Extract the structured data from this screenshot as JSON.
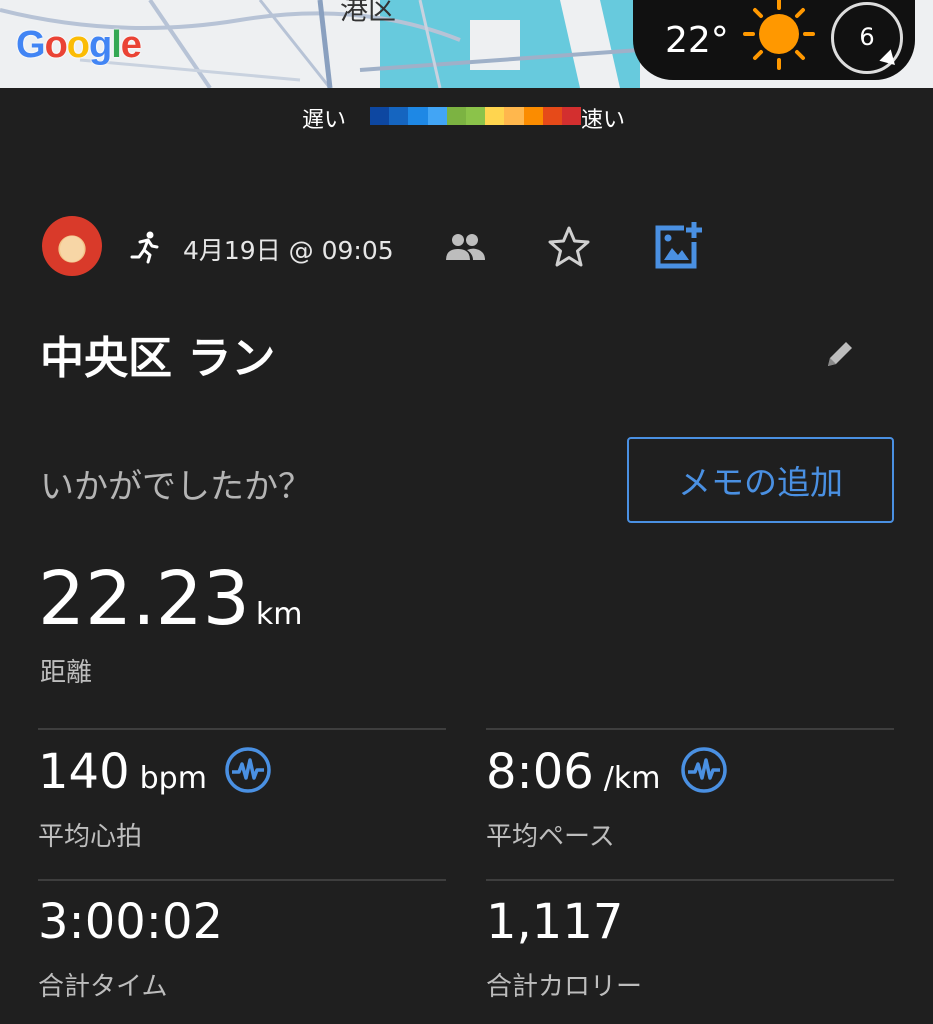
{
  "map": {
    "provider_logo": "Google",
    "area_label": "港区",
    "weather": {
      "temperature": "22°",
      "icon": "sun-icon",
      "wind_speed": "6"
    }
  },
  "pace_legend": {
    "slow_label": "遅い",
    "fast_label": "速い",
    "colors": [
      "#0d47a1",
      "#1565c0",
      "#1e88e5",
      "#42a5f5",
      "#7cb342",
      "#8bc34a",
      "#ffd54f",
      "#ffb74d",
      "#fb8c00",
      "#e64a19",
      "#d32f2f"
    ]
  },
  "activity": {
    "avatar": "avatar-matryoshka",
    "type_icon": "running-icon",
    "date": "4月19日 @ 09:05",
    "title": "中央区 ラン",
    "question": "いかがでしたか？",
    "memo_button": "メモの追加"
  },
  "distance": {
    "value": "22.23",
    "unit": "km",
    "label": "距離"
  },
  "stats": {
    "avg_hr": {
      "value": "140",
      "unit": "bpm",
      "label": "平均心拍"
    },
    "avg_pace": {
      "value": "8:06",
      "unit": "/km",
      "label": "平均ペース"
    },
    "total_time": {
      "value": "3:00:02",
      "label": "合計タイム"
    },
    "total_calories": {
      "value": "1,117",
      "label": "合計カロリー"
    }
  },
  "colors": {
    "accent": "#4a90e2",
    "background": "#1f1f1f",
    "label": "#bdbdbd"
  }
}
